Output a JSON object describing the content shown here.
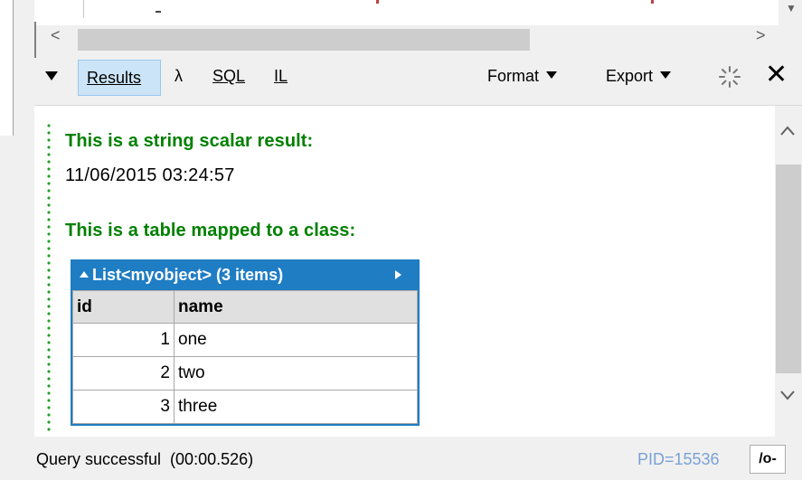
{
  "toolbar": {
    "results_label": "Results",
    "lambda_label": "λ",
    "sql_label": "SQL",
    "il_label": "IL",
    "format_label": "Format",
    "export_label": "Export",
    "close_label": "✕"
  },
  "output": {
    "scalar_heading": "This is a string scalar result:",
    "scalar_value": "11/06/2015 03:24:57",
    "table_heading": "This is a table mapped to a class:",
    "table": {
      "caption": "List<myobject> (3 items)",
      "columns": [
        "id",
        "name"
      ],
      "rows": [
        [
          "1",
          "one"
        ],
        [
          "2",
          "two"
        ],
        [
          "3",
          "three"
        ]
      ]
    }
  },
  "status": {
    "message": "Query successful  (00:00.526)",
    "pid": "PID=15536",
    "button_label": "/o-"
  },
  "colors": {
    "heading_green": "#008000",
    "table_blue": "#1f7dc4",
    "pid_blue": "#7aa2d6"
  }
}
